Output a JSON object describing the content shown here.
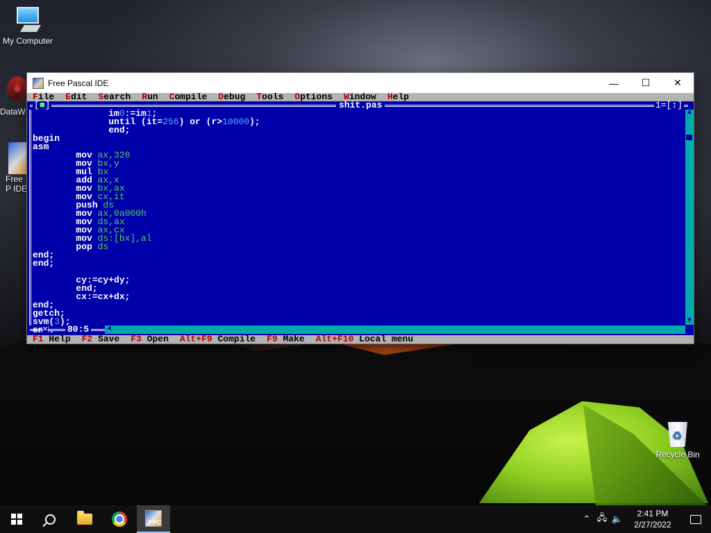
{
  "desktop": {
    "icons": [
      {
        "label": "My Computer"
      },
      {
        "label": "DataW"
      },
      {
        "label": "Free P IDE"
      },
      {
        "label": "Recycle Bin"
      }
    ]
  },
  "window": {
    "title": "Free Pascal IDE",
    "controls": {
      "minimize": "—",
      "maximize": "☐",
      "close": "✕"
    }
  },
  "menu": [
    {
      "hotkey": "F",
      "rest": "ile"
    },
    {
      "hotkey": "E",
      "rest": "dit"
    },
    {
      "hotkey": "S",
      "rest": "earch"
    },
    {
      "hotkey": "R",
      "rest": "un"
    },
    {
      "hotkey": "C",
      "rest": "ompile"
    },
    {
      "hotkey": "D",
      "rest": "ebug"
    },
    {
      "hotkey": "T",
      "rest": "ools"
    },
    {
      "hotkey": "O",
      "rest": "ptions"
    },
    {
      "hotkey": "W",
      "rest": "indow"
    },
    {
      "hotkey": "H",
      "rest": "elp"
    }
  ],
  "editor": {
    "filename": "shit.pas",
    "close_box": "[■]",
    "window_number": "1=[↕]",
    "cursor_pos": "80:5",
    "lines": [
      "              im0:=im1;",
      "              until (it=256) or (r>10000);",
      "              end;",
      "begin",
      "asm",
      "        mov ax,320",
      "        mov bx,y",
      "        mul bx",
      "        add ax,x",
      "        mov bx,ax",
      "        mov cx,it",
      "        push ds",
      "        mov ax,0a000h",
      "        mov ds,ax",
      "        mov ax,cx",
      "        mov ds:[bx],al",
      "        pop ds",
      "end;",
      "end;",
      "",
      "        cy:=cy+dy;",
      "        end;",
      "        cx:=cx+dx;",
      "end;",
      "getch;",
      "svm(3);",
      "end."
    ]
  },
  "statusbar": [
    {
      "key": "F1",
      "label": "Help"
    },
    {
      "key": "F2",
      "label": "Save"
    },
    {
      "key": "F3",
      "label": "Open"
    },
    {
      "key": "Alt+F9",
      "label": "Compile"
    },
    {
      "key": "F9",
      "label": "Make"
    },
    {
      "key": "Alt+F10",
      "label": "Local menu"
    }
  ],
  "taskbar": {
    "time": "2:41 PM",
    "date": "2/27/2022",
    "tray_icons": [
      "chevron-up-icon",
      "network-icon",
      "volume-icon"
    ]
  }
}
